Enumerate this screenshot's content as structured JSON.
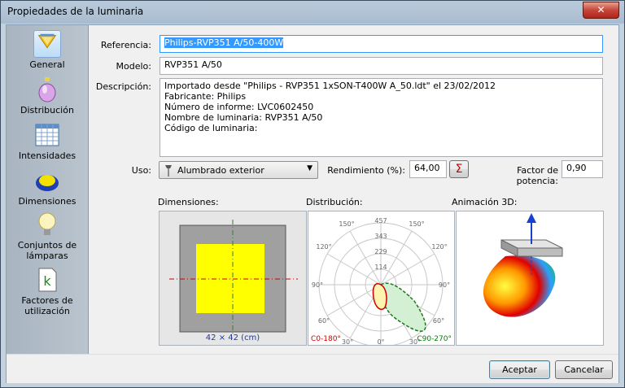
{
  "window": {
    "title": "Propiedades de la luminaria",
    "close_glyph": "✕"
  },
  "sidebar": {
    "items": [
      {
        "label": "General",
        "icon": "lamp-general-icon",
        "selected": true
      },
      {
        "label": "Distribución",
        "icon": "distribution-bottle-icon"
      },
      {
        "label": "Intensidades",
        "icon": "table-grid-icon"
      },
      {
        "label": "Dimensiones",
        "icon": "luminaire-shape-icon"
      },
      {
        "label": "Conjuntos de lámparas",
        "icon": "light-bulb-icon"
      },
      {
        "label": "Factores de utilización",
        "icon": "k-factor-icon"
      }
    ]
  },
  "form": {
    "referencia_label": "Referencia:",
    "referencia_value": "Philips-RVP351 A/50-400W",
    "modelo_label": "Modelo:",
    "modelo_value": "RVP351 A/50",
    "descripcion_label": "Descripción:",
    "descripcion_lines": [
      "Importado desde \"Philips - RVP351 1xSON-T400W A_50.ldt\" el 23/02/2012",
      "Fabricante: Philips",
      "Número de informe: LVC0602450",
      "Nombre de luminaria: RVP351 A/50",
      "Código de luminaria:"
    ],
    "uso_label": "Uso:",
    "uso_value": "Alumbrado exterior",
    "rendimiento_label": "Rendimiento (%):",
    "rendimiento_value": "64,00",
    "sigma_glyph": "Σ",
    "factor_label": "Factor de potencia:",
    "factor_value": "0,90"
  },
  "panels": {
    "dimensiones_title": "Dimensiones:",
    "dimensiones_caption": "42 × 42 (cm)",
    "distribucion_title": "Distribución:",
    "animacion_title": "Animación 3D:",
    "polar": {
      "radial_labels": [
        "457",
        "343",
        "229",
        "114"
      ],
      "angle_labels_left": [
        "150°",
        "120°",
        "90°",
        "60°",
        "30°"
      ],
      "angle_labels_right": [
        "150°",
        "120°",
        "90°",
        "60°",
        "30°"
      ],
      "bottom_label": "0°",
      "legend_left": "C0-180°",
      "legend_right": "C90-270°",
      "legend_left_color": "#cc0000",
      "legend_right_color": "#008000"
    }
  },
  "buttons": {
    "accept": "Aceptar",
    "cancel": "Cancelar"
  }
}
